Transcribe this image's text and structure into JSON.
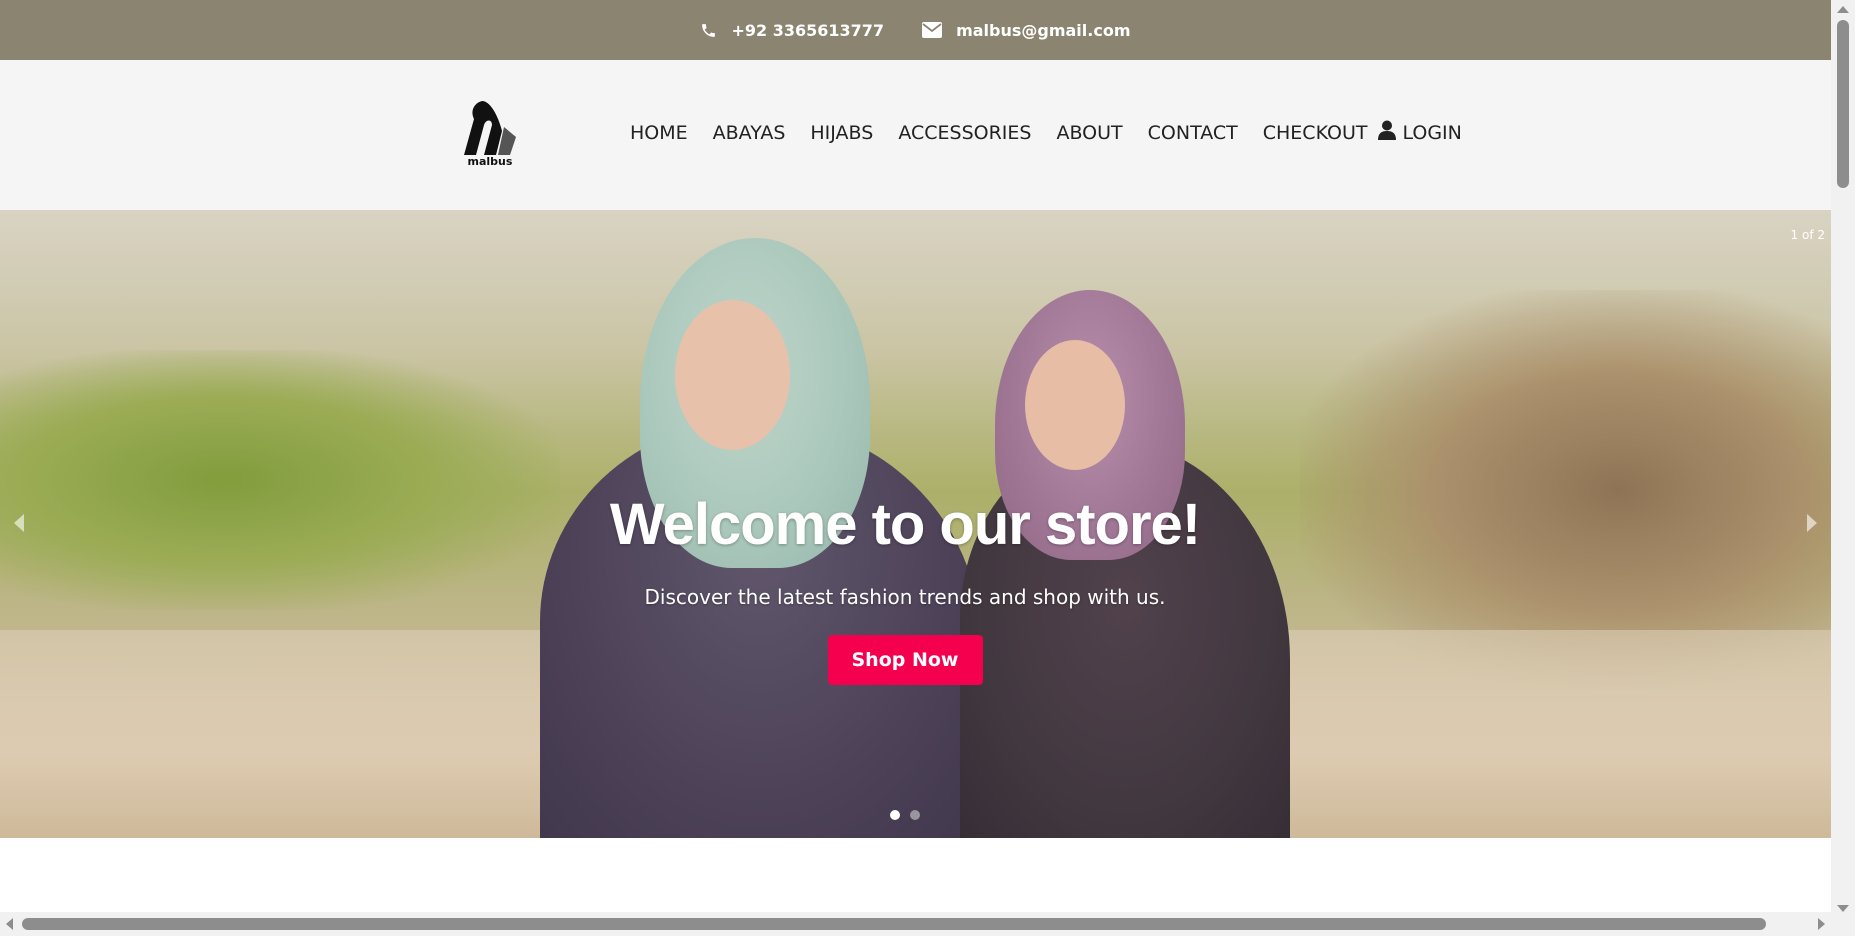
{
  "topbar": {
    "phone": "+92 3365613777",
    "email": "malbus@gmail.com",
    "background": "#8b8470"
  },
  "logo": {
    "text": "malbus"
  },
  "nav": {
    "items": [
      {
        "label": "HOME"
      },
      {
        "label": "ABAYAS"
      },
      {
        "label": "HIJABS"
      },
      {
        "label": "ACCESSORIES"
      },
      {
        "label": "ABOUT"
      },
      {
        "label": "CONTACT"
      },
      {
        "label": "CHECKOUT"
      }
    ],
    "login_label": "LOGIN",
    "login_icon": "user-icon"
  },
  "hero": {
    "counter": "1 of 2",
    "current_slide": 1,
    "total_slides": 2,
    "title": "Welcome to our store!",
    "subtitle": "Discover the latest fashion trends and shop with us.",
    "button_label": "Shop Now",
    "button_color": "#f5004f",
    "prev_icon": "chevron-left-icon",
    "next_icon": "chevron-right-icon"
  }
}
